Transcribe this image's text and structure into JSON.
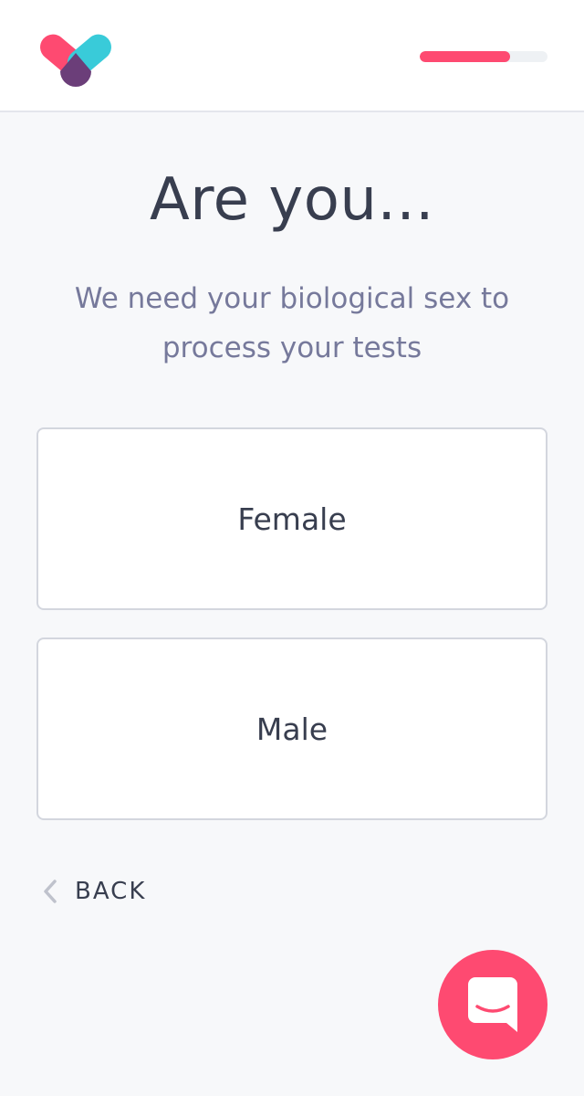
{
  "header": {
    "logo_icon": "heart-logo-icon",
    "progress": 0.71,
    "progress_color": "#fe4a71"
  },
  "main": {
    "title": "Are you...",
    "subtitle": "We need your biological sex to process your tests",
    "options": [
      {
        "label": "Female"
      },
      {
        "label": "Male"
      }
    ]
  },
  "nav": {
    "back_icon": "chevron-left-icon",
    "back_label": "BACK"
  },
  "chat": {
    "icon": "chat-bubble-icon",
    "color": "#fe4a71"
  }
}
